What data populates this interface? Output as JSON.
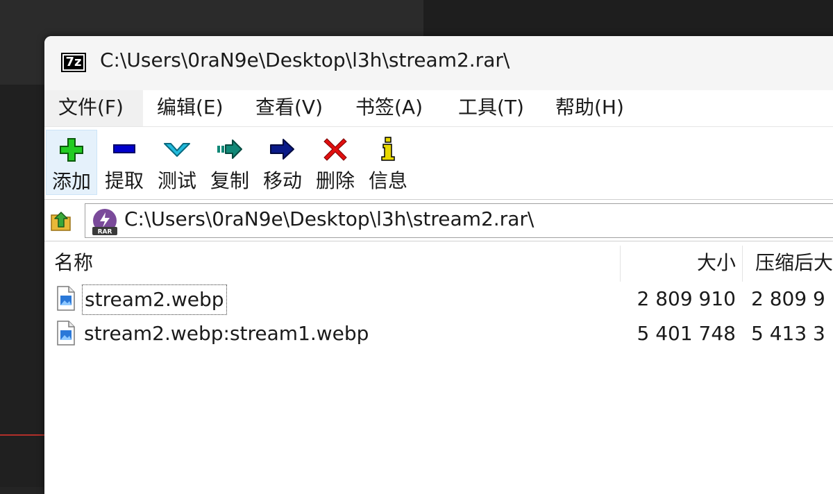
{
  "window": {
    "title": "C:\\Users\\0raN9e\\Desktop\\l3h\\stream2.rar\\",
    "app_icon_text": "7z"
  },
  "menu": [
    {
      "label": "文件(F)"
    },
    {
      "label": "编辑(E)"
    },
    {
      "label": "查看(V)"
    },
    {
      "label": "书签(A)"
    },
    {
      "label": "工具(T)"
    },
    {
      "label": "帮助(H)"
    }
  ],
  "toolbar": [
    {
      "label": "添加",
      "icon": "add-icon",
      "color": "#22cc22"
    },
    {
      "label": "提取",
      "icon": "extract-icon",
      "color": "#0000cc"
    },
    {
      "label": "测试",
      "icon": "test-icon",
      "color": "#22bbdd"
    },
    {
      "label": "复制",
      "icon": "copy-icon",
      "color": "#118877"
    },
    {
      "label": "移动",
      "icon": "move-icon",
      "color": "#0a1a88"
    },
    {
      "label": "删除",
      "icon": "delete-icon",
      "color": "#e01010"
    },
    {
      "label": "信息",
      "icon": "info-icon",
      "color": "#e8d800"
    }
  ],
  "address": {
    "path": "C:\\Users\\0raN9e\\Desktop\\l3h\\stream2.rar\\",
    "archive_icon_text": "RAR"
  },
  "columns": {
    "name": "名称",
    "size": "大小",
    "packed": "压缩后大"
  },
  "files": [
    {
      "name": "stream2.webp",
      "size": "2 809 910",
      "packed": "2 809 9"
    },
    {
      "name": "stream2.webp:stream1.webp",
      "size": "5 401 748",
      "packed": "5 413 3"
    }
  ]
}
